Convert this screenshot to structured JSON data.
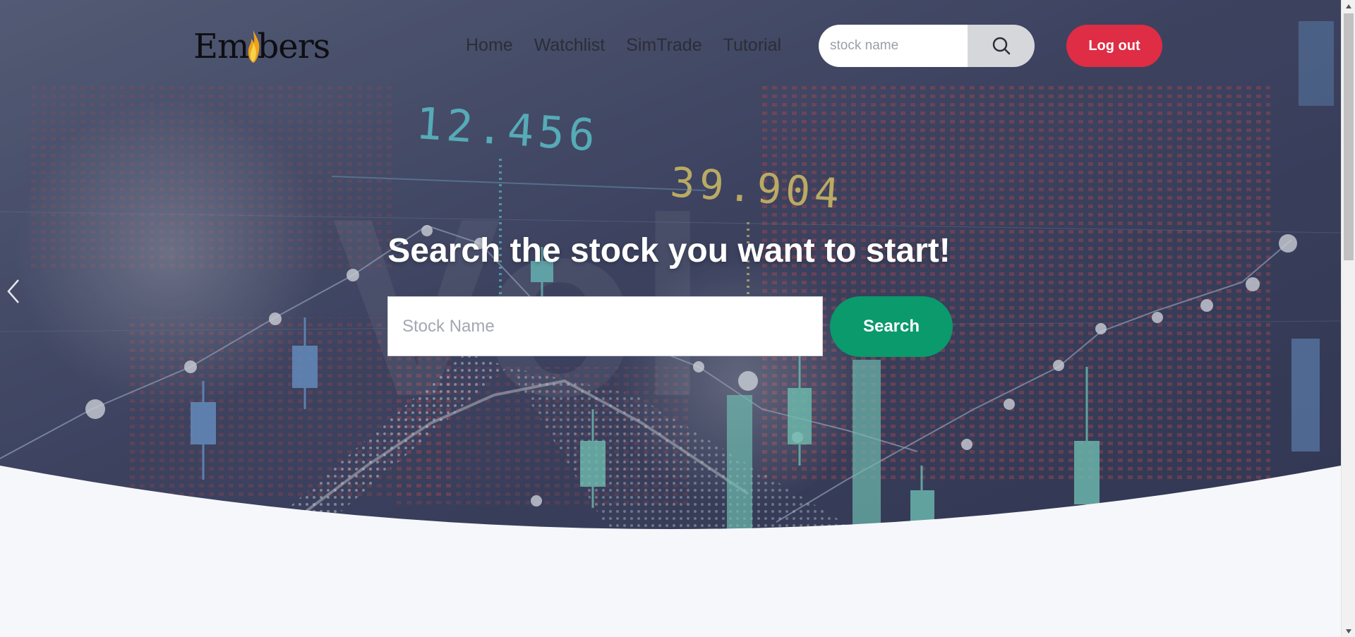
{
  "brand": {
    "name_left": "Em",
    "name_right": "bers",
    "flame_color": "#f0a21a"
  },
  "nav": {
    "items": [
      {
        "label": "Home"
      },
      {
        "label": "Watchlist"
      },
      {
        "label": "SimTrade"
      },
      {
        "label": "Tutorial"
      }
    ]
  },
  "header_search": {
    "placeholder": "stock name",
    "icon": "search-icon"
  },
  "logout": {
    "label": "Log out",
    "color": "#de2d44"
  },
  "hero": {
    "title": "Search the stock you want to start!",
    "search_placeholder": "Stock Name",
    "search_button": "Search",
    "search_button_color": "#0a9a6b",
    "background_numbers": [
      "12.456",
      "39.904"
    ],
    "prev_icon": "chevron-left-icon"
  },
  "colors": {
    "hero_tint": "#3f4560",
    "page_background": "#f6f7fb"
  }
}
